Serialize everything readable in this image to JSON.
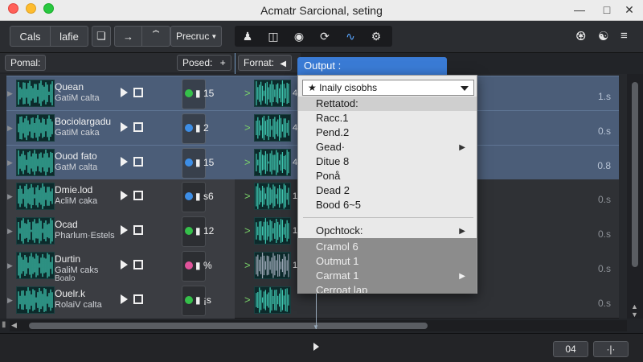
{
  "window": {
    "title": "Acmatr Sarcional, seting",
    "controls": [
      "minimize",
      "maximize",
      "close"
    ]
  },
  "toolbar": {
    "group1": [
      "Cals",
      "lafie"
    ],
    "group2_menu_label": "Precruc",
    "icons_left": [
      "clip-icon",
      "arrow-right-icon",
      "bars-icon"
    ],
    "icons_dark": [
      "user-icon",
      "file-icon",
      "comment-icon",
      "refresh-icon",
      "waveform-icon",
      "gear-icon"
    ],
    "icons_right": [
      "mixer-icon",
      "split-icon",
      "list-icon"
    ]
  },
  "header": {
    "left_label": "Pomal:",
    "posed_label": "Posed:",
    "posed_add": "+",
    "format_label": "Fornat:",
    "format_arrow": "◀"
  },
  "tracks": [
    {
      "name": "Quean",
      "sub": "GatiM calta",
      "sub2": "",
      "count": "15",
      "dot_color": "#35c04a",
      "wave_num": "4",
      "value": "1.s",
      "selected": true
    },
    {
      "name": "Bociolargadu",
      "sub": "GatiM caka",
      "sub2": "",
      "count": "2",
      "dot_color": "#3d8ee6",
      "wave_num": "4",
      "value": "0.s",
      "selected": true
    },
    {
      "name": "Ouod fato",
      "sub": "GatM calta",
      "sub2": "",
      "count": "15",
      "dot_color": "#3d8ee6",
      "wave_num": "4",
      "value": "0.8",
      "selected": true
    },
    {
      "name": "Dmie.lod",
      "sub": "AcliM caka",
      "sub2": "",
      "count": "s6",
      "dot_color": "#3d8ee6",
      "wave_num": "1",
      "value": "0.s",
      "selected": false
    },
    {
      "name": "Ocad",
      "sub": "Pharlum·Estels",
      "sub2": "",
      "count": "12",
      "dot_color": "#35c04a",
      "wave_num": "1",
      "value": "0.s",
      "selected": false
    },
    {
      "name": "Durtin",
      "sub": "GaliM caks",
      "sub2": "Boalo",
      "count": "%",
      "dot_color": "#e0529a",
      "wave_num": "1",
      "value": "0.s",
      "selected": false
    },
    {
      "name": "Ouelr.k",
      "sub": "RolaiV calta",
      "sub2": "",
      "count": "¡s",
      "dot_color": "#35c04a",
      "wave_num": "",
      "value": "0.s",
      "selected": false
    }
  ],
  "output_panel": {
    "header": "Output :",
    "select_value": "★ Inaily cisobhs",
    "items": [
      {
        "label": "Rettatod:",
        "highlight": true,
        "submenu": false
      },
      {
        "label": "Racc.1",
        "highlight": false,
        "submenu": false
      },
      {
        "label": "Pend.2",
        "highlight": false,
        "submenu": false
      },
      {
        "label": "Gead·",
        "highlight": false,
        "submenu": true
      },
      {
        "label": "Ditue 8",
        "highlight": false,
        "submenu": false
      },
      {
        "label": "Ponå",
        "highlight": false,
        "submenu": false
      },
      {
        "label": "Dead 2",
        "highlight": false,
        "submenu": false
      },
      {
        "label": "Bood 6~5",
        "highlight": false,
        "submenu": false
      }
    ],
    "section_label": "Opchtock:",
    "disabled_items": [
      {
        "label": "Cramol 6",
        "submenu": false
      },
      {
        "label": "Outmut 1",
        "submenu": false
      },
      {
        "label": "Carmat 1",
        "submenu": true
      },
      {
        "label": "Cerroat lap",
        "submenu": false
      }
    ]
  },
  "bottom": {
    "btn1_label": "04",
    "btn2_label": "·|·"
  }
}
